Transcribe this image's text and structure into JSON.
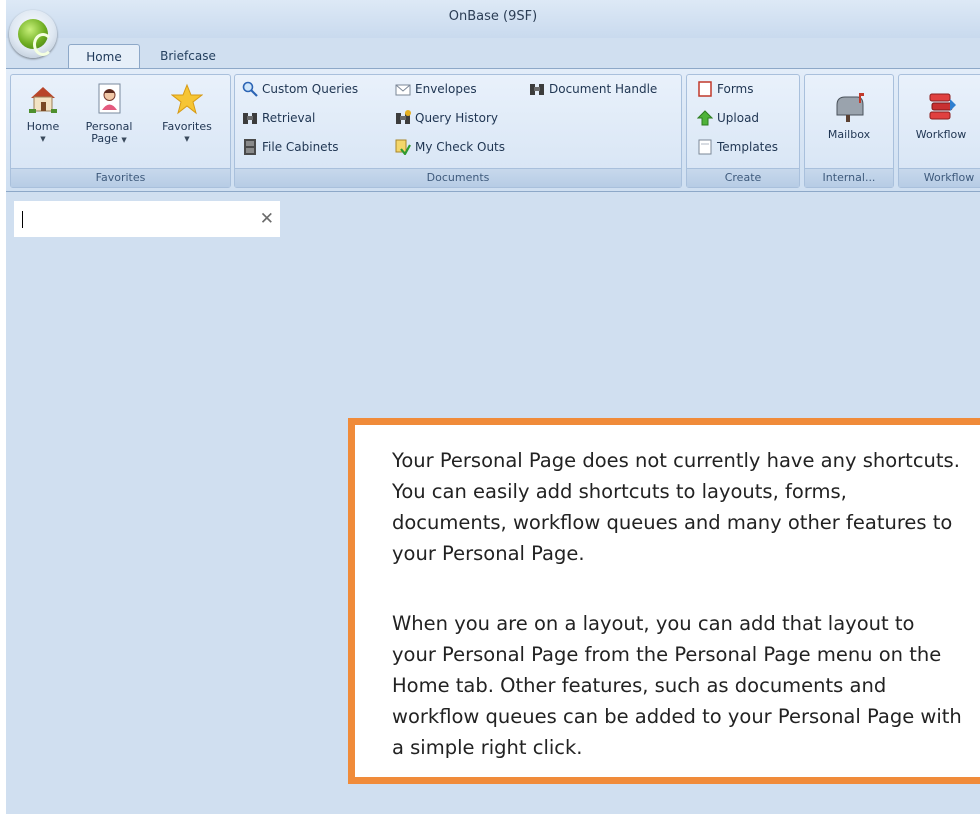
{
  "window": {
    "title": "OnBase (9SF)"
  },
  "tabs": [
    {
      "label": "Home"
    },
    {
      "label": "Briefcase"
    }
  ],
  "ribbon": {
    "favorites": {
      "label": "Favorites",
      "buttons": [
        {
          "label": "Home",
          "icon": "house-icon"
        },
        {
          "label_line1": "Personal",
          "label_line2": "Page",
          "icon": "person-page-icon"
        },
        {
          "label": "Favorites",
          "icon": "star-icon"
        }
      ]
    },
    "documents": {
      "label": "Documents",
      "items": [
        {
          "label": "Custom Queries",
          "icon": "magnifier-icon"
        },
        {
          "label": "Retrieval",
          "icon": "binoculars-icon"
        },
        {
          "label": "File Cabinets",
          "icon": "file-cabinet-icon"
        },
        {
          "label": "Envelopes",
          "icon": "envelope-icon"
        },
        {
          "label": "Query History",
          "icon": "binoculars-history-icon"
        },
        {
          "label": "My Check Outs",
          "icon": "checkout-icon"
        },
        {
          "label": "Document Handle",
          "icon": "binoculars-icon"
        }
      ]
    },
    "create": {
      "label": "Create",
      "items": [
        {
          "label": "Forms",
          "icon": "form-icon"
        },
        {
          "label": "Upload",
          "icon": "upload-arrow-icon"
        },
        {
          "label": "Templates",
          "icon": "template-icon"
        }
      ]
    },
    "internal": {
      "label": "Internal...",
      "button": "Mailbox"
    },
    "workflow": {
      "label": "Workflow",
      "button": "Workflow"
    }
  },
  "search": {
    "value": "",
    "placeholder": ""
  },
  "message": {
    "paragraph1": "Your Personal Page does not currently have any shortcuts. You can easily add shortcuts to layouts, forms, documents, workflow queues and many other features to your Personal Page.",
    "paragraph2": "When you are on a layout, you can add that layout to your Personal Page from the Personal Page menu on the Home tab. Other features, such as documents and workflow queues can be added to your Personal Page with a simple right click."
  },
  "colors": {
    "callout_border": "#f08b3a",
    "app_background": "#d0dff0"
  }
}
